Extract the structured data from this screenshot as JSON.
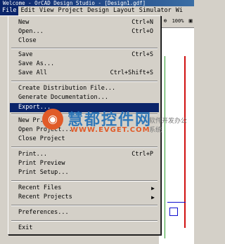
{
  "window": {
    "title": "Welcome - OrCAD Design Studio - [Design1.gdf]"
  },
  "menubar": {
    "items": [
      "File",
      "Edit",
      "View",
      "Project",
      "Design",
      "Layout",
      "Simulator",
      "Wi"
    ]
  },
  "toolbar": {
    "zoom": "100%"
  },
  "file_menu": {
    "new": {
      "label": "New",
      "shortcut": "Ctrl+N"
    },
    "open": {
      "label": "Open...",
      "shortcut": "Ctrl+O"
    },
    "close": {
      "label": "Close"
    },
    "save": {
      "label": "Save",
      "shortcut": "Ctrl+S"
    },
    "save_as": {
      "label": "Save As..."
    },
    "save_all": {
      "label": "Save All",
      "shortcut": "Ctrl+Shift+S"
    },
    "create_dist": {
      "label": "Create Distribution File..."
    },
    "gen_docs": {
      "label": "Generate Documentation..."
    },
    "export": {
      "label": "Export..."
    },
    "new_project": {
      "label": "New Pr..."
    },
    "open_project": {
      "label": "Open Project..."
    },
    "close_project": {
      "label": "Close Project"
    },
    "print": {
      "label": "Print...",
      "shortcut": "Ctrl+P"
    },
    "print_preview": {
      "label": "Print Preview"
    },
    "print_setup": {
      "label": "Print Setup..."
    },
    "recent_files": {
      "label": "Recent Files"
    },
    "recent_projects": {
      "label": "Recent Projects"
    },
    "preferences": {
      "label": "Preferences..."
    },
    "exit": {
      "label": "Exit"
    }
  },
  "watermark": {
    "title": "慧都控件网",
    "url": "WWW.EVGET.COM",
    "side_text": "软件开发办公系统"
  }
}
